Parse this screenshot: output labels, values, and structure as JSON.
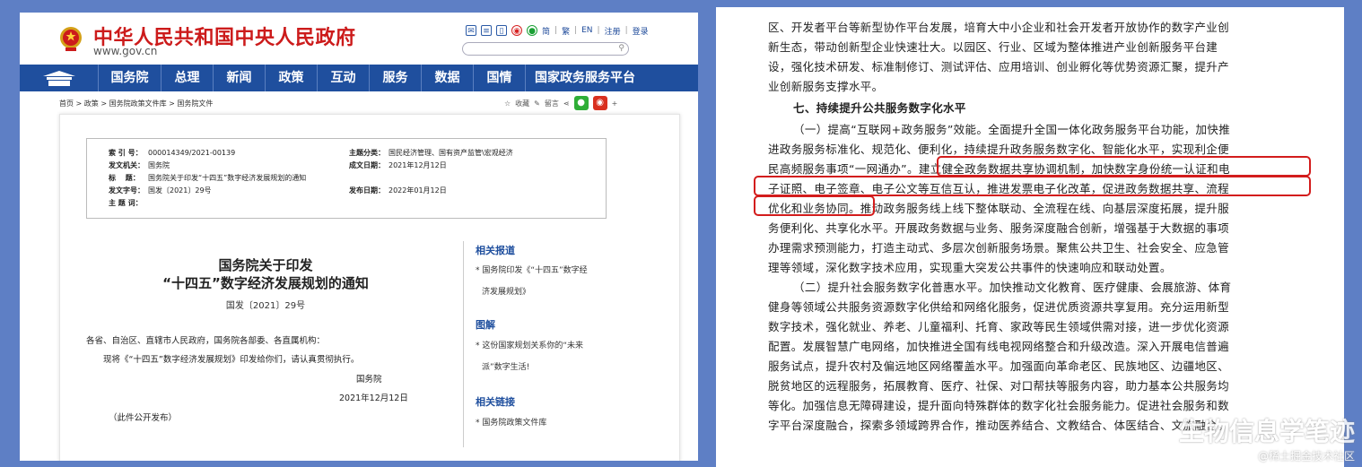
{
  "left": {
    "header": {
      "site_name": "中华人民共和国中央人民政府",
      "site_url": "www.gov.cn",
      "icons": [
        "mail-icon",
        "rss-icon",
        "mobile-icon",
        "weibo-icon",
        "wechat-icon"
      ],
      "lang_links": [
        "简",
        "繁",
        "EN",
        "注册",
        "登录"
      ],
      "search_placeholder": ""
    },
    "nav": [
      "国务院",
      "总理",
      "新闻",
      "政策",
      "互动",
      "服务",
      "数据",
      "国情",
      "国家政务服务平台"
    ],
    "breadcrumb": "首页 > 政策 > 国务院政策文件库 > 国务院文件",
    "tools": {
      "favorite": "收藏",
      "comment": "留言"
    },
    "meta": {
      "index_no_label": "索 引 号：",
      "index_no": "000014349/2021-00139",
      "theme_label": "主题分类：",
      "theme": "国民经济管理、国有资产监管\\宏观经济",
      "issuer_label": "发文机关：",
      "issuer": "国务院",
      "date_label": "成文日期：",
      "date": "2021年12月12日",
      "title_label": "标　 题：",
      "title": "国务院关于印发“十四五”数字经济发展规划的通知",
      "docno_label": "发文字号：",
      "docno": "国发〔2021〕29号",
      "pub_label": "发布日期：",
      "pub": "2022年01月12日",
      "subject_label": "主 题 词：",
      "subject": ""
    },
    "doc": {
      "title_line1": "国务院关于印发",
      "title_line2": "“十四五”数字经济发展规划的通知",
      "doc_no": "国发〔2021〕29号",
      "addressee": "各省、自治区、直辖市人民政府，国务院各部委、各直属机构：",
      "body": "现将《“十四五”数字经济发展规划》印发给你们，请认真贯彻执行。",
      "sign": "国务院",
      "sign_date": "2021年12月12日",
      "note": "（此件公开发布）"
    },
    "sidebar": {
      "related_title": "相关报道",
      "related_1a": "* 国务院印发《“十四五”数字经",
      "related_1b": "济发展规划》",
      "graphic_title": "图解",
      "graphic_1a": "* 这份国家规划关系你的“未来",
      "graphic_1b": "派”数字生活!",
      "links_title": "相关链接",
      "links_1": "* 国务院政策文件库"
    }
  },
  "right": {
    "lines": [
      "区、开发者平台等新型协作平台发展，培育大中小企业和社会开发者开放协作的数字产业创",
      "新生态，带动创新型企业快速壮大。以园区、行业、区域为整体推进产业创新服务平台建",
      "设，强化技术研发、标准制修订、测试评估、应用培训、创业孵化等优势资源汇聚，提升产",
      "业创新服务支撑水平。",
      "七、持续提升公共服务数字化水平",
      "（一）提高“互联网+政务服务”效能。全面提升全国一体化政务服务平台功能，加快推",
      "进政务服务标准化、规范化、便利化，持续提升政务服务数字化、智能化水平，实现利企便",
      "民高频服务事项“一网通办”。建立健全政务数据共享协调机制，加快数字身份统一认证和电",
      "子证照、电子签章、电子公文等互信互认，推进发票电子化改革，促进政务数据共享、流程",
      "优化和业务协同。推动政务服务线上线下整体联动、全流程在线、向基层深度拓展，提升服",
      "务便利化、共享化水平。开展政务数据与业务、服务深度融合创新，增强基于大数据的事项",
      "办理需求预测能力，打造主动式、多层次创新服务场景。聚焦公共卫生、社会安全、应急管",
      "理等领域，深化数字技术应用，实现重大突发公共事件的快速响应和联动处置。",
      "（二）提升社会服务数字化普惠水平。加快推动文化教育、医疗健康、会展旅游、体育",
      "健身等领域公共服务资源数字化供给和网络化服务，促进优质资源共享复用。充分运用新型",
      "数字技术，强化就业、养老、儿童福利、托育、家政等民生领域供需对接，进一步优化资源",
      "配置。发展智慧广电网络，加快推进全国有线电视网络整合和升级改造。深入开展电信普遍",
      "服务试点，提升农村及偏远地区网络覆盖水平。加强面向革命老区、民族地区、边疆地区、",
      "脱贫地区的远程服务，拓展教育、医疗、社保、对口帮扶等服务内容，助力基本公共服务均",
      "等化。加强信息无障碍建设，提升面向特殊群体的数字化社会服务能力。促进社会服务和数",
      "字平台深度融合，探索多领域跨界合作，推动医养结合、文教结合、体医结合、文旅融合。"
    ]
  },
  "watermark": {
    "main": "生物信息学笔迹",
    "sub": "@稀土掘金技术社区"
  },
  "colors": {
    "background": "#5e7fc5",
    "nav": "#1f4f9e",
    "brand_red": "#cc1b1b",
    "highlight": "#d31c1c"
  }
}
